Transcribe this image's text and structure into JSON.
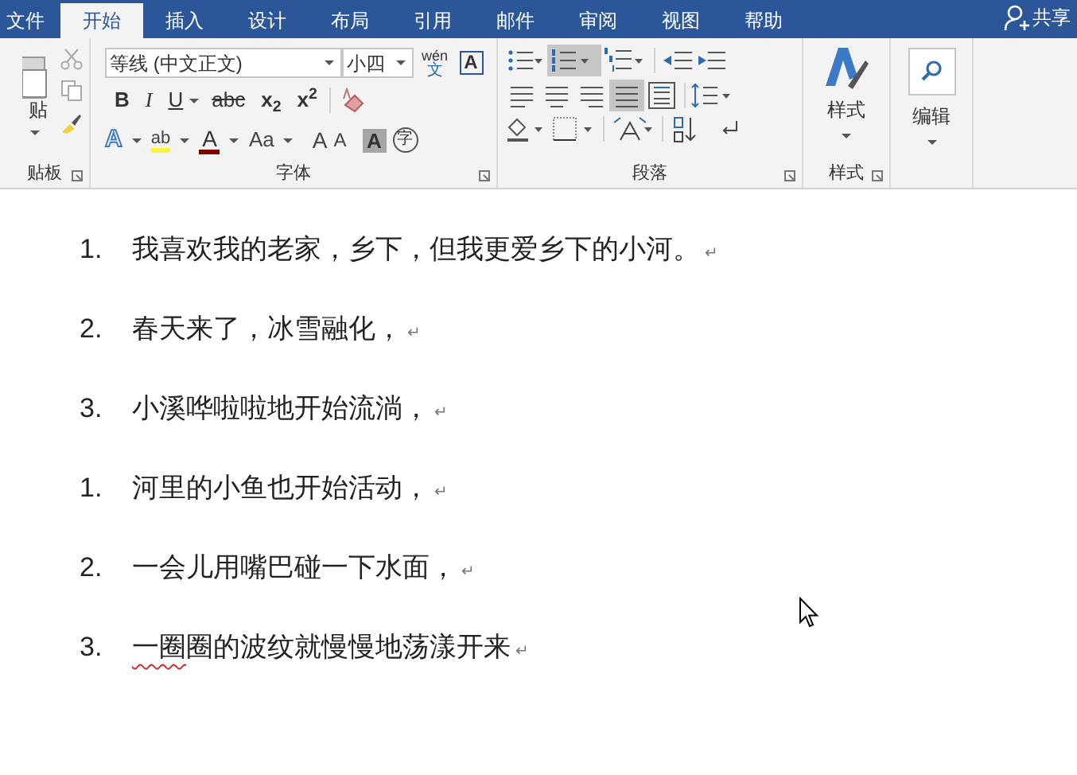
{
  "tabs": [
    {
      "label": "文件",
      "selected": false
    },
    {
      "label": "开始",
      "selected": true
    },
    {
      "label": "插入",
      "selected": false
    },
    {
      "label": "设计",
      "selected": false
    },
    {
      "label": "布局",
      "selected": false
    },
    {
      "label": "引用",
      "selected": false
    },
    {
      "label": "邮件",
      "selected": false
    },
    {
      "label": "审阅",
      "selected": false
    },
    {
      "label": "视图",
      "selected": false
    },
    {
      "label": "帮助",
      "selected": false
    }
  ],
  "share": "共享",
  "clipboard": {
    "paste_label": "贴",
    "group_label": "贴板"
  },
  "font": {
    "font_name": "等线 (中文正文)",
    "font_size": "小四",
    "phonetic_top": "wén",
    "phonetic_bottom": "文",
    "border_char": "A",
    "row1": [
      {
        "kind": "bold",
        "text": "B"
      },
      {
        "kind": "italic",
        "text": "I"
      },
      {
        "kind": "underline",
        "text": "U"
      },
      {
        "kind": "strike",
        "text": "abc"
      },
      {
        "kind": "sub",
        "text": "x$_{2}$"
      },
      {
        "kind": "sup",
        "text": "x$^{2}$"
      }
    ],
    "row2": [
      {
        "kind": "effects",
        "text": "A"
      },
      {
        "kind": "highlight",
        "text": "ab"
      },
      {
        "kind": "color",
        "text": "A"
      },
      {
        "kind": "case",
        "text": "Aa"
      },
      {
        "kind": "grow",
        "text": "A"
      },
      {
        "kind": "shrink",
        "text": "A"
      },
      {
        "kind": "shading",
        "text": "A"
      },
      {
        "kind": "enclose",
        "text": "字"
      }
    ],
    "group_label": "字体"
  },
  "paragraph": {
    "bullets_selected": false,
    "numbering_selected": true,
    "multilevel_selected": false,
    "align_left_selected": false,
    "align_center_selected": false,
    "align_right_selected": false,
    "justify_selected": true,
    "distributed_selected": false,
    "group_label": "段落"
  },
  "styles": {
    "button_label": "样式",
    "group_label": "样式"
  },
  "editing": {
    "button_label": "编辑"
  },
  "document": {
    "items": [
      {
        "number": "1.",
        "segments": [
          {
            "text": "我喜欢我的老家，乡下，但我更爱乡下的小河。",
            "misspelled": false
          }
        ],
        "mark": "↵"
      },
      {
        "number": "2.",
        "segments": [
          {
            "text": "春天来了，冰雪融化，",
            "misspelled": false
          }
        ],
        "mark": "↵"
      },
      {
        "number": "3.",
        "segments": [
          {
            "text": "小溪哗啦啦地开始流淌，",
            "misspelled": false
          }
        ],
        "mark": "↵"
      },
      {
        "number": "1.",
        "segments": [
          {
            "text": "河里的小鱼也开始活动，",
            "misspelled": false
          }
        ],
        "mark": "↵"
      },
      {
        "number": "2.",
        "segments": [
          {
            "text": "一会儿用嘴巴碰一下水面，",
            "misspelled": false
          }
        ],
        "mark": "↵"
      },
      {
        "number": "3.",
        "segments": [
          {
            "text": "一圈",
            "misspelled": true
          },
          {
            "text": "圈的波纹就慢慢地荡漾开来",
            "misspelled": false
          }
        ],
        "mark": "↵"
      }
    ]
  }
}
